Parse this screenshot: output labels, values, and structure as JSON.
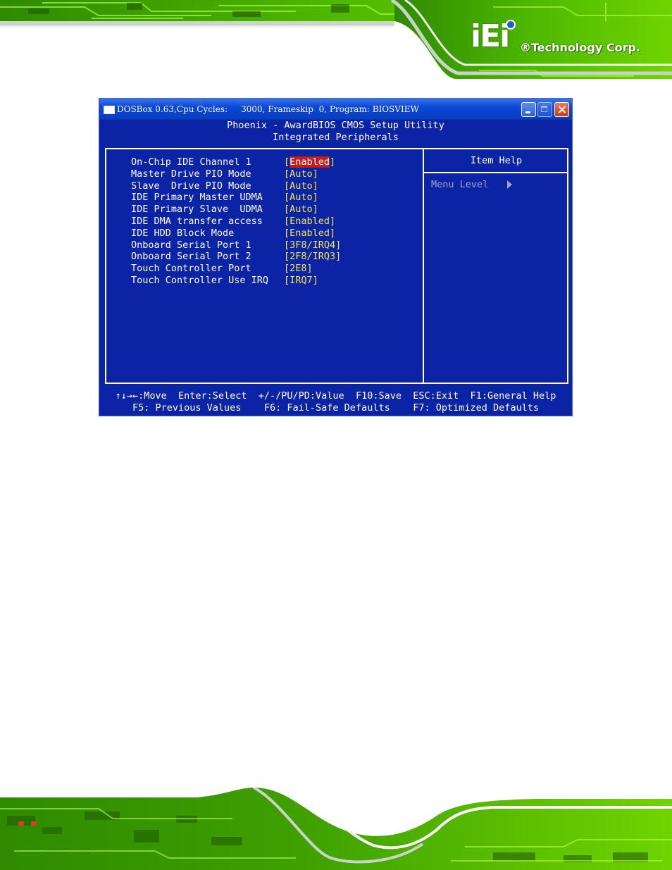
{
  "brand": {
    "logo_mark": "iEi",
    "logo_text": "®Technology Corp."
  },
  "window": {
    "title": "DOSBox 0.63,Cpu Cycles:     3000, Frameskip  0, Program: BIOSVIEW"
  },
  "bios": {
    "title_line1": "Phoenix - AwardBIOS CMOS Setup Utility",
    "title_line2": "Integrated Peripherals",
    "settings": [
      {
        "label": "On-Chip IDE Channel 1",
        "value_open": "[",
        "value": "Enabled",
        "value_close": "]",
        "selected": true
      },
      {
        "label": "Master Drive PIO Mode",
        "value_open": "[",
        "value": "Auto",
        "value_close": "]"
      },
      {
        "label": "Slave  Drive PIO Mode",
        "value_open": "[",
        "value": "Auto",
        "value_close": "]"
      },
      {
        "label": "IDE Primary Master UDMA",
        "value_open": "[",
        "value": "Auto",
        "value_close": "]"
      },
      {
        "label": "IDE Primary Slave  UDMA",
        "value_open": "[",
        "value": "Auto",
        "value_close": "]"
      },
      {
        "label": "IDE DMA transfer access",
        "value_open": "[",
        "value": "Enabled",
        "value_close": "]"
      },
      {
        "label": "IDE HDD Block Mode",
        "value_open": "[",
        "value": "Enabled",
        "value_close": "]"
      },
      {
        "label": "Onboard Serial Port 1",
        "value_open": "[",
        "value": "3F8/IRQ4",
        "value_close": "]"
      },
      {
        "label": "Onboard Serial Port 2",
        "value_open": "[",
        "value": "2F8/IRQ3",
        "value_close": "]"
      },
      {
        "label": "Touch Controller Port",
        "value_open": "[",
        "value": "2E8",
        "value_close": "]"
      },
      {
        "label": "Touch Controller Use IRQ",
        "value_open": "[",
        "value": "IRQ7",
        "value_close": "]"
      }
    ],
    "help": {
      "title": "Item Help",
      "menu_level": "Menu Level"
    },
    "keys_line1": "↑↓→←:Move  Enter:Select  +/-/PU/PD:Value  F10:Save  ESC:Exit  F1:General Help",
    "keys_line2": "F5: Previous Values    F6: Fail-Safe Defaults    F7: Optimized Defaults"
  },
  "colors": {
    "bios_background": "#0a24a5",
    "bios_value": "#f6e24a",
    "bios_selected": "#c61b1b",
    "banner_green": "#6fd400",
    "titlebar_blue": "#0a46d8"
  },
  "icons": {
    "window_icon": "dosbox-window-icon",
    "minimize": "minimize-icon",
    "maximize": "maximize-icon",
    "close": "close-icon",
    "menu_level_arrow": "triangle-right-icon"
  }
}
